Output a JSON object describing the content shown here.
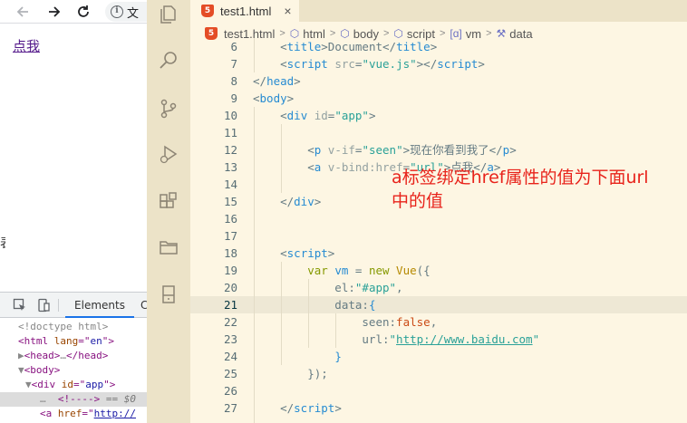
{
  "browser": {
    "address_text": "文",
    "page_link": "点我",
    "edge_glyph": "表",
    "devtools": {
      "tab_elements": "Elements",
      "tab_next": "C",
      "dom": [
        {
          "indent": 1,
          "parts": [
            [
              "t-gray",
              "<!doctype html>"
            ]
          ]
        },
        {
          "indent": 1,
          "parts": [
            [
              "t-tag",
              "<html "
            ],
            [
              "t-attr",
              "lang"
            ],
            [
              "t-tag",
              "=\""
            ],
            [
              "t-val",
              "en"
            ],
            [
              "t-tag",
              "\">"
            ]
          ]
        },
        {
          "indent": 1,
          "parts": [
            [
              "t-gray",
              "▶"
            ],
            [
              "t-tag",
              "<head>"
            ],
            [
              "t-gray",
              "…"
            ],
            [
              "t-tag",
              "</head>"
            ]
          ]
        },
        {
          "indent": 1,
          "parts": [
            [
              "t-gray",
              "▼"
            ],
            [
              "t-tag",
              "<body>"
            ]
          ]
        },
        {
          "indent": 2,
          "parts": [
            [
              "t-gray",
              "▼"
            ],
            [
              "t-tag",
              "<div "
            ],
            [
              "t-attr",
              "id"
            ],
            [
              "t-tag",
              "=\""
            ],
            [
              "t-val",
              "app"
            ],
            [
              "t-tag",
              "\">"
            ]
          ]
        },
        {
          "indent": 4,
          "selected": true,
          "parts": [
            [
              "t-gray",
              "…  "
            ],
            [
              "t-tag",
              "<!---->"
            ],
            [
              "t-dim",
              " == $0"
            ]
          ]
        },
        {
          "indent": 4,
          "parts": [
            [
              "t-tag",
              "<a "
            ],
            [
              "t-attr",
              "href"
            ],
            [
              "t-tag",
              "=\""
            ],
            [
              "t-link",
              "http://"
            ]
          ]
        }
      ]
    }
  },
  "activity_icons": [
    "files-icon",
    "search-icon",
    "source-control-icon",
    "run-debug-icon",
    "extensions-icon",
    "folder-icon",
    "remote-icon"
  ],
  "editor": {
    "tab_label": "test1.html",
    "tab_close": "×",
    "breadcrumb": [
      {
        "label": "test1.html",
        "icon": "html5-icon"
      },
      {
        "label": "html",
        "icon": "cube-icon"
      },
      {
        "label": "body",
        "icon": "cube-icon"
      },
      {
        "label": "script",
        "icon": "cube-icon"
      },
      {
        "label": "vm",
        "icon": "variable-icon"
      },
      {
        "label": "data",
        "icon": "wrench-icon"
      }
    ],
    "lines": [
      {
        "n": "6",
        "parts": [
          [
            "k-plain",
            "    <"
          ],
          [
            "k-tag",
            "title"
          ],
          [
            "k-plain",
            ">Document</"
          ],
          [
            "k-tag",
            "title"
          ],
          [
            "k-plain",
            ">"
          ]
        ]
      },
      {
        "n": "7",
        "parts": [
          [
            "k-plain",
            "    <"
          ],
          [
            "k-tag",
            "script"
          ],
          [
            "k-attr",
            " src"
          ],
          [
            "k-plain",
            "="
          ],
          [
            "k-str",
            "\"vue.js\""
          ],
          [
            "k-plain",
            "></"
          ],
          [
            "k-tag",
            "script"
          ],
          [
            "k-plain",
            ">"
          ]
        ]
      },
      {
        "n": "8",
        "parts": [
          [
            "k-plain",
            "</"
          ],
          [
            "k-tag",
            "head"
          ],
          [
            "k-plain",
            ">"
          ]
        ]
      },
      {
        "n": "9",
        "parts": [
          [
            "k-plain",
            "<"
          ],
          [
            "k-tag",
            "body"
          ],
          [
            "k-plain",
            ">"
          ]
        ]
      },
      {
        "n": "10",
        "parts": [
          [
            "k-plain",
            "    <"
          ],
          [
            "k-tag",
            "div"
          ],
          [
            "k-attr",
            " id"
          ],
          [
            "k-plain",
            "="
          ],
          [
            "k-str",
            "\"app\""
          ],
          [
            "k-plain",
            ">"
          ]
        ]
      },
      {
        "n": "11",
        "parts": []
      },
      {
        "n": "12",
        "parts": [
          [
            "k-plain",
            "        <"
          ],
          [
            "k-tag",
            "p"
          ],
          [
            "k-attr",
            " v-if"
          ],
          [
            "k-plain",
            "="
          ],
          [
            "k-str",
            "\"seen\""
          ],
          [
            "k-plain",
            ">现在你看到我了</"
          ],
          [
            "k-tag",
            "p"
          ],
          [
            "k-plain",
            ">"
          ]
        ]
      },
      {
        "n": "13",
        "parts": [
          [
            "k-plain",
            "        <"
          ],
          [
            "k-tag",
            "a"
          ],
          [
            "k-attr",
            " v-bind:href"
          ],
          [
            "k-plain",
            "="
          ],
          [
            "k-str",
            "\"url\""
          ],
          [
            "k-plain",
            ">点我</"
          ],
          [
            "k-tag",
            "a"
          ],
          [
            "k-plain",
            ">"
          ]
        ]
      },
      {
        "n": "14",
        "parts": []
      },
      {
        "n": "15",
        "parts": [
          [
            "k-plain",
            "    </"
          ],
          [
            "k-tag",
            "div"
          ],
          [
            "k-plain",
            ">"
          ]
        ]
      },
      {
        "n": "16",
        "parts": []
      },
      {
        "n": "17",
        "parts": []
      },
      {
        "n": "18",
        "parts": [
          [
            "k-plain",
            "    <"
          ],
          [
            "k-tag",
            "script"
          ],
          [
            "k-plain",
            ">"
          ]
        ]
      },
      {
        "n": "19",
        "parts": [
          [
            "k-plain",
            "        "
          ],
          [
            "k-kw",
            "var"
          ],
          [
            "k-tag",
            " vm"
          ],
          [
            "k-plain",
            " = "
          ],
          [
            "k-kw",
            "new"
          ],
          [
            "k-fn",
            " Vue"
          ],
          [
            "k-plain",
            "({"
          ]
        ]
      },
      {
        "n": "20",
        "parts": [
          [
            "k-plain",
            "            el:"
          ],
          [
            "k-str",
            "\"#app\""
          ],
          [
            "k-plain",
            ","
          ]
        ]
      },
      {
        "n": "21",
        "active": true,
        "parts": [
          [
            "k-plain",
            "            data:"
          ],
          [
            "k-tag",
            "{"
          ]
        ]
      },
      {
        "n": "22",
        "parts": [
          [
            "k-plain",
            "                seen:"
          ],
          [
            "k-bool",
            "false"
          ],
          [
            "k-plain",
            ","
          ]
        ]
      },
      {
        "n": "23",
        "parts": [
          [
            "k-plain",
            "                url:"
          ],
          [
            "k-str",
            "\""
          ],
          [
            "k-url",
            "http://www.baidu.com"
          ],
          [
            "k-str",
            "\""
          ]
        ]
      },
      {
        "n": "24",
        "parts": [
          [
            "k-plain",
            "            "
          ],
          [
            "k-tag",
            "}"
          ]
        ]
      },
      {
        "n": "25",
        "parts": [
          [
            "k-plain",
            "        });"
          ]
        ]
      },
      {
        "n": "26",
        "parts": []
      },
      {
        "n": "27",
        "parts": [
          [
            "k-plain",
            "    </"
          ],
          [
            "k-tag",
            "script"
          ],
          [
            "k-plain",
            ">"
          ]
        ]
      }
    ],
    "annotation_line1": "a标签绑定href属性的值为下面url",
    "annotation_line2": "中的值"
  }
}
